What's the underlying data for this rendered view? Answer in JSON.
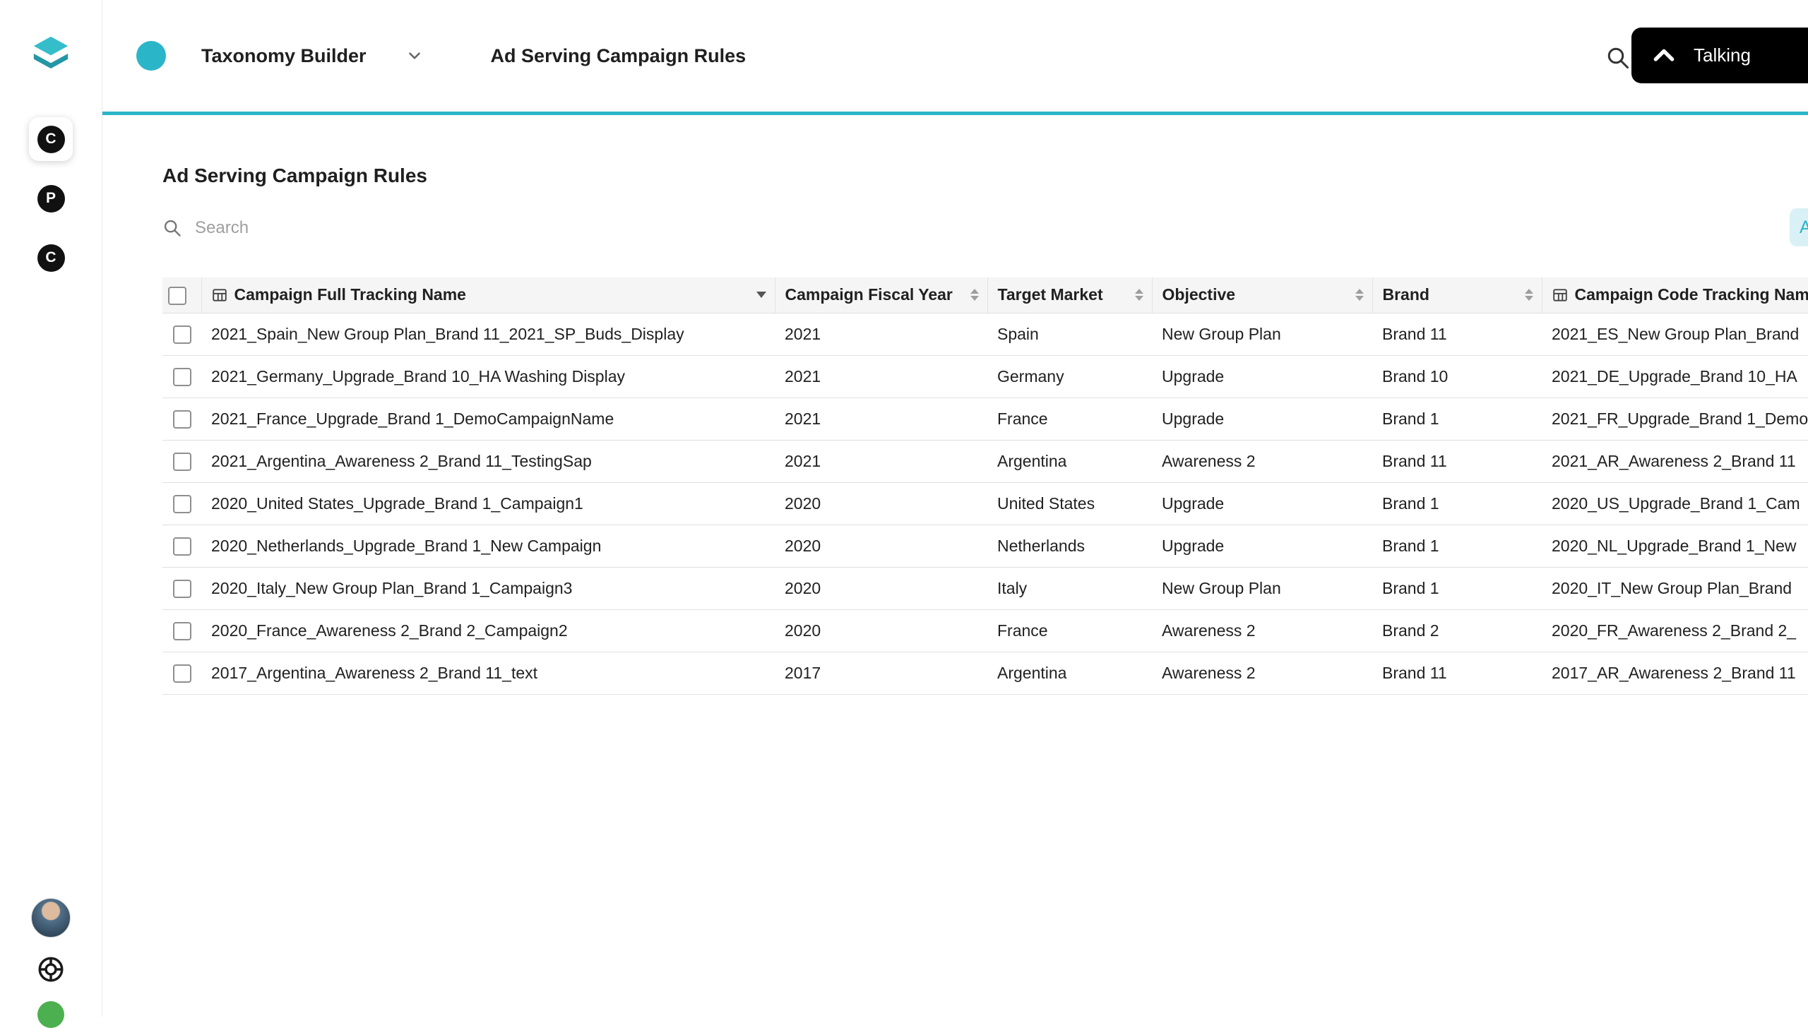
{
  "colors": {
    "accent": "#2bb5c8",
    "accent_light": "#d9f1f6",
    "table_header_bg": "#f5f5f5",
    "status_green": "#4caf50"
  },
  "sidebar": {
    "nav_items": [
      {
        "label": "C",
        "active": true
      },
      {
        "label": "P",
        "active": false
      },
      {
        "label": "C",
        "active": false
      }
    ]
  },
  "header": {
    "app_title": "Taxonomy Builder",
    "page_title": "Ad Serving Campaign Rules",
    "talking_button_label": "Talking"
  },
  "content": {
    "title": "Ad Serving Campaign Rules",
    "search_placeholder": "Search",
    "add_button_label": "Add"
  },
  "table": {
    "columns": [
      {
        "label": "Campaign Full Tracking Name",
        "icon": "table-icon",
        "sort": "desc"
      },
      {
        "label": "Campaign Fiscal Year",
        "sortable": true
      },
      {
        "label": "Target Market",
        "sortable": true
      },
      {
        "label": "Objective",
        "sortable": true
      },
      {
        "label": "Brand",
        "sortable": true
      },
      {
        "label": "Campaign Code Tracking Name",
        "icon": "table-icon"
      }
    ],
    "rows": [
      {
        "name": "2021_Spain_New Group Plan_Brand 11_2021_SP_Buds_Display",
        "fiscal_year": "2021",
        "target_market": "Spain",
        "objective": "New Group Plan",
        "brand": "Brand 11",
        "code": "2021_ES_New Group Plan_Brand"
      },
      {
        "name": "2021_Germany_Upgrade_Brand 10_HA Washing Display",
        "fiscal_year": "2021",
        "target_market": "Germany",
        "objective": "Upgrade",
        "brand": "Brand 10",
        "code": "2021_DE_Upgrade_Brand 10_HA"
      },
      {
        "name": "2021_France_Upgrade_Brand 1_DemoCampaignName",
        "fiscal_year": "2021",
        "target_market": "France",
        "objective": "Upgrade",
        "brand": "Brand 1",
        "code": "2021_FR_Upgrade_Brand 1_Demo"
      },
      {
        "name": "2021_Argentina_Awareness 2_Brand 11_TestingSap",
        "fiscal_year": "2021",
        "target_market": "Argentina",
        "objective": "Awareness 2",
        "brand": "Brand 11",
        "code": "2021_AR_Awareness 2_Brand 11"
      },
      {
        "name": "2020_United States_Upgrade_Brand 1_Campaign1",
        "fiscal_year": "2020",
        "target_market": "United States",
        "objective": "Upgrade",
        "brand": "Brand 1",
        "code": "2020_US_Upgrade_Brand 1_Cam"
      },
      {
        "name": "2020_Netherlands_Upgrade_Brand 1_New Campaign",
        "fiscal_year": "2020",
        "target_market": "Netherlands",
        "objective": "Upgrade",
        "brand": "Brand 1",
        "code": "2020_NL_Upgrade_Brand 1_New"
      },
      {
        "name": "2020_Italy_New Group Plan_Brand 1_Campaign3",
        "fiscal_year": "2020",
        "target_market": "Italy",
        "objective": "New Group Plan",
        "brand": "Brand 1",
        "code": "2020_IT_New Group Plan_Brand"
      },
      {
        "name": "2020_France_Awareness 2_Brand 2_Campaign2",
        "fiscal_year": "2020",
        "target_market": "France",
        "objective": "Awareness 2",
        "brand": "Brand 2",
        "code": "2020_FR_Awareness 2_Brand 2_"
      },
      {
        "name": "2017_Argentina_Awareness 2_Brand 11_text",
        "fiscal_year": "2017",
        "target_market": "Argentina",
        "objective": "Awareness 2",
        "brand": "Brand 11",
        "code": "2017_AR_Awareness 2_Brand 11"
      }
    ]
  }
}
